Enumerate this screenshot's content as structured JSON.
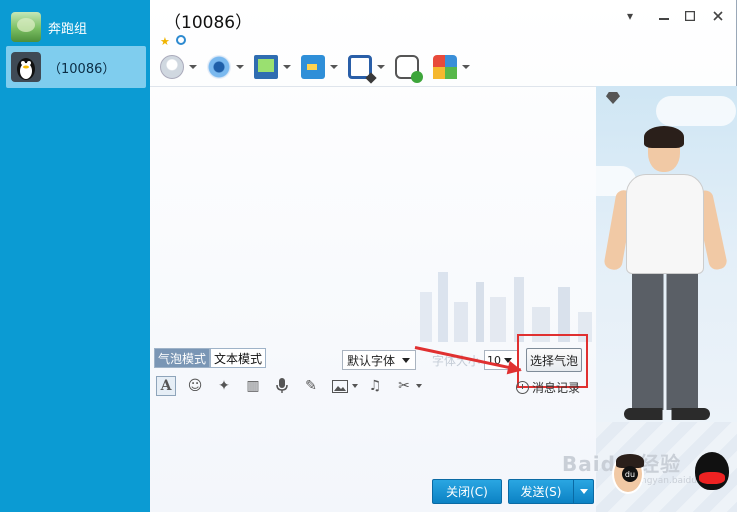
{
  "sidebar": {
    "items": [
      {
        "label": "奔跑组"
      },
      {
        "label": "（10086）"
      }
    ]
  },
  "window": {
    "title": "（10086）"
  },
  "toolbar": {
    "tools": [
      "microphone-icon",
      "webcam-icon",
      "screen-share-icon",
      "file-transfer-icon",
      "remote-desktop-icon",
      "new-chat-icon",
      "apps-icon"
    ]
  },
  "editor": {
    "mode_bubble": "气泡模式",
    "mode_text": "文本模式",
    "font_name": "默认字体",
    "font_size_label": "字体大小",
    "font_size": "10",
    "choose_bubble": "选择气泡",
    "history": "消息记录",
    "format_tools": [
      "font-icon",
      "emoji-icon",
      "magic-icon",
      "snapshot-icon",
      "voice-icon",
      "note-icon",
      "image-icon",
      "music-icon",
      "scissors-icon"
    ]
  },
  "actions": {
    "close": "关闭(C)",
    "send": "发送(S)"
  },
  "watermark": {
    "text": "Baidu 经验",
    "sub": "jingyan.baidu.com",
    "badge": "du"
  },
  "colors": {
    "sidebar": "#0b9bd3",
    "accent_button": "#1593d4",
    "annotation": "#e03030"
  }
}
